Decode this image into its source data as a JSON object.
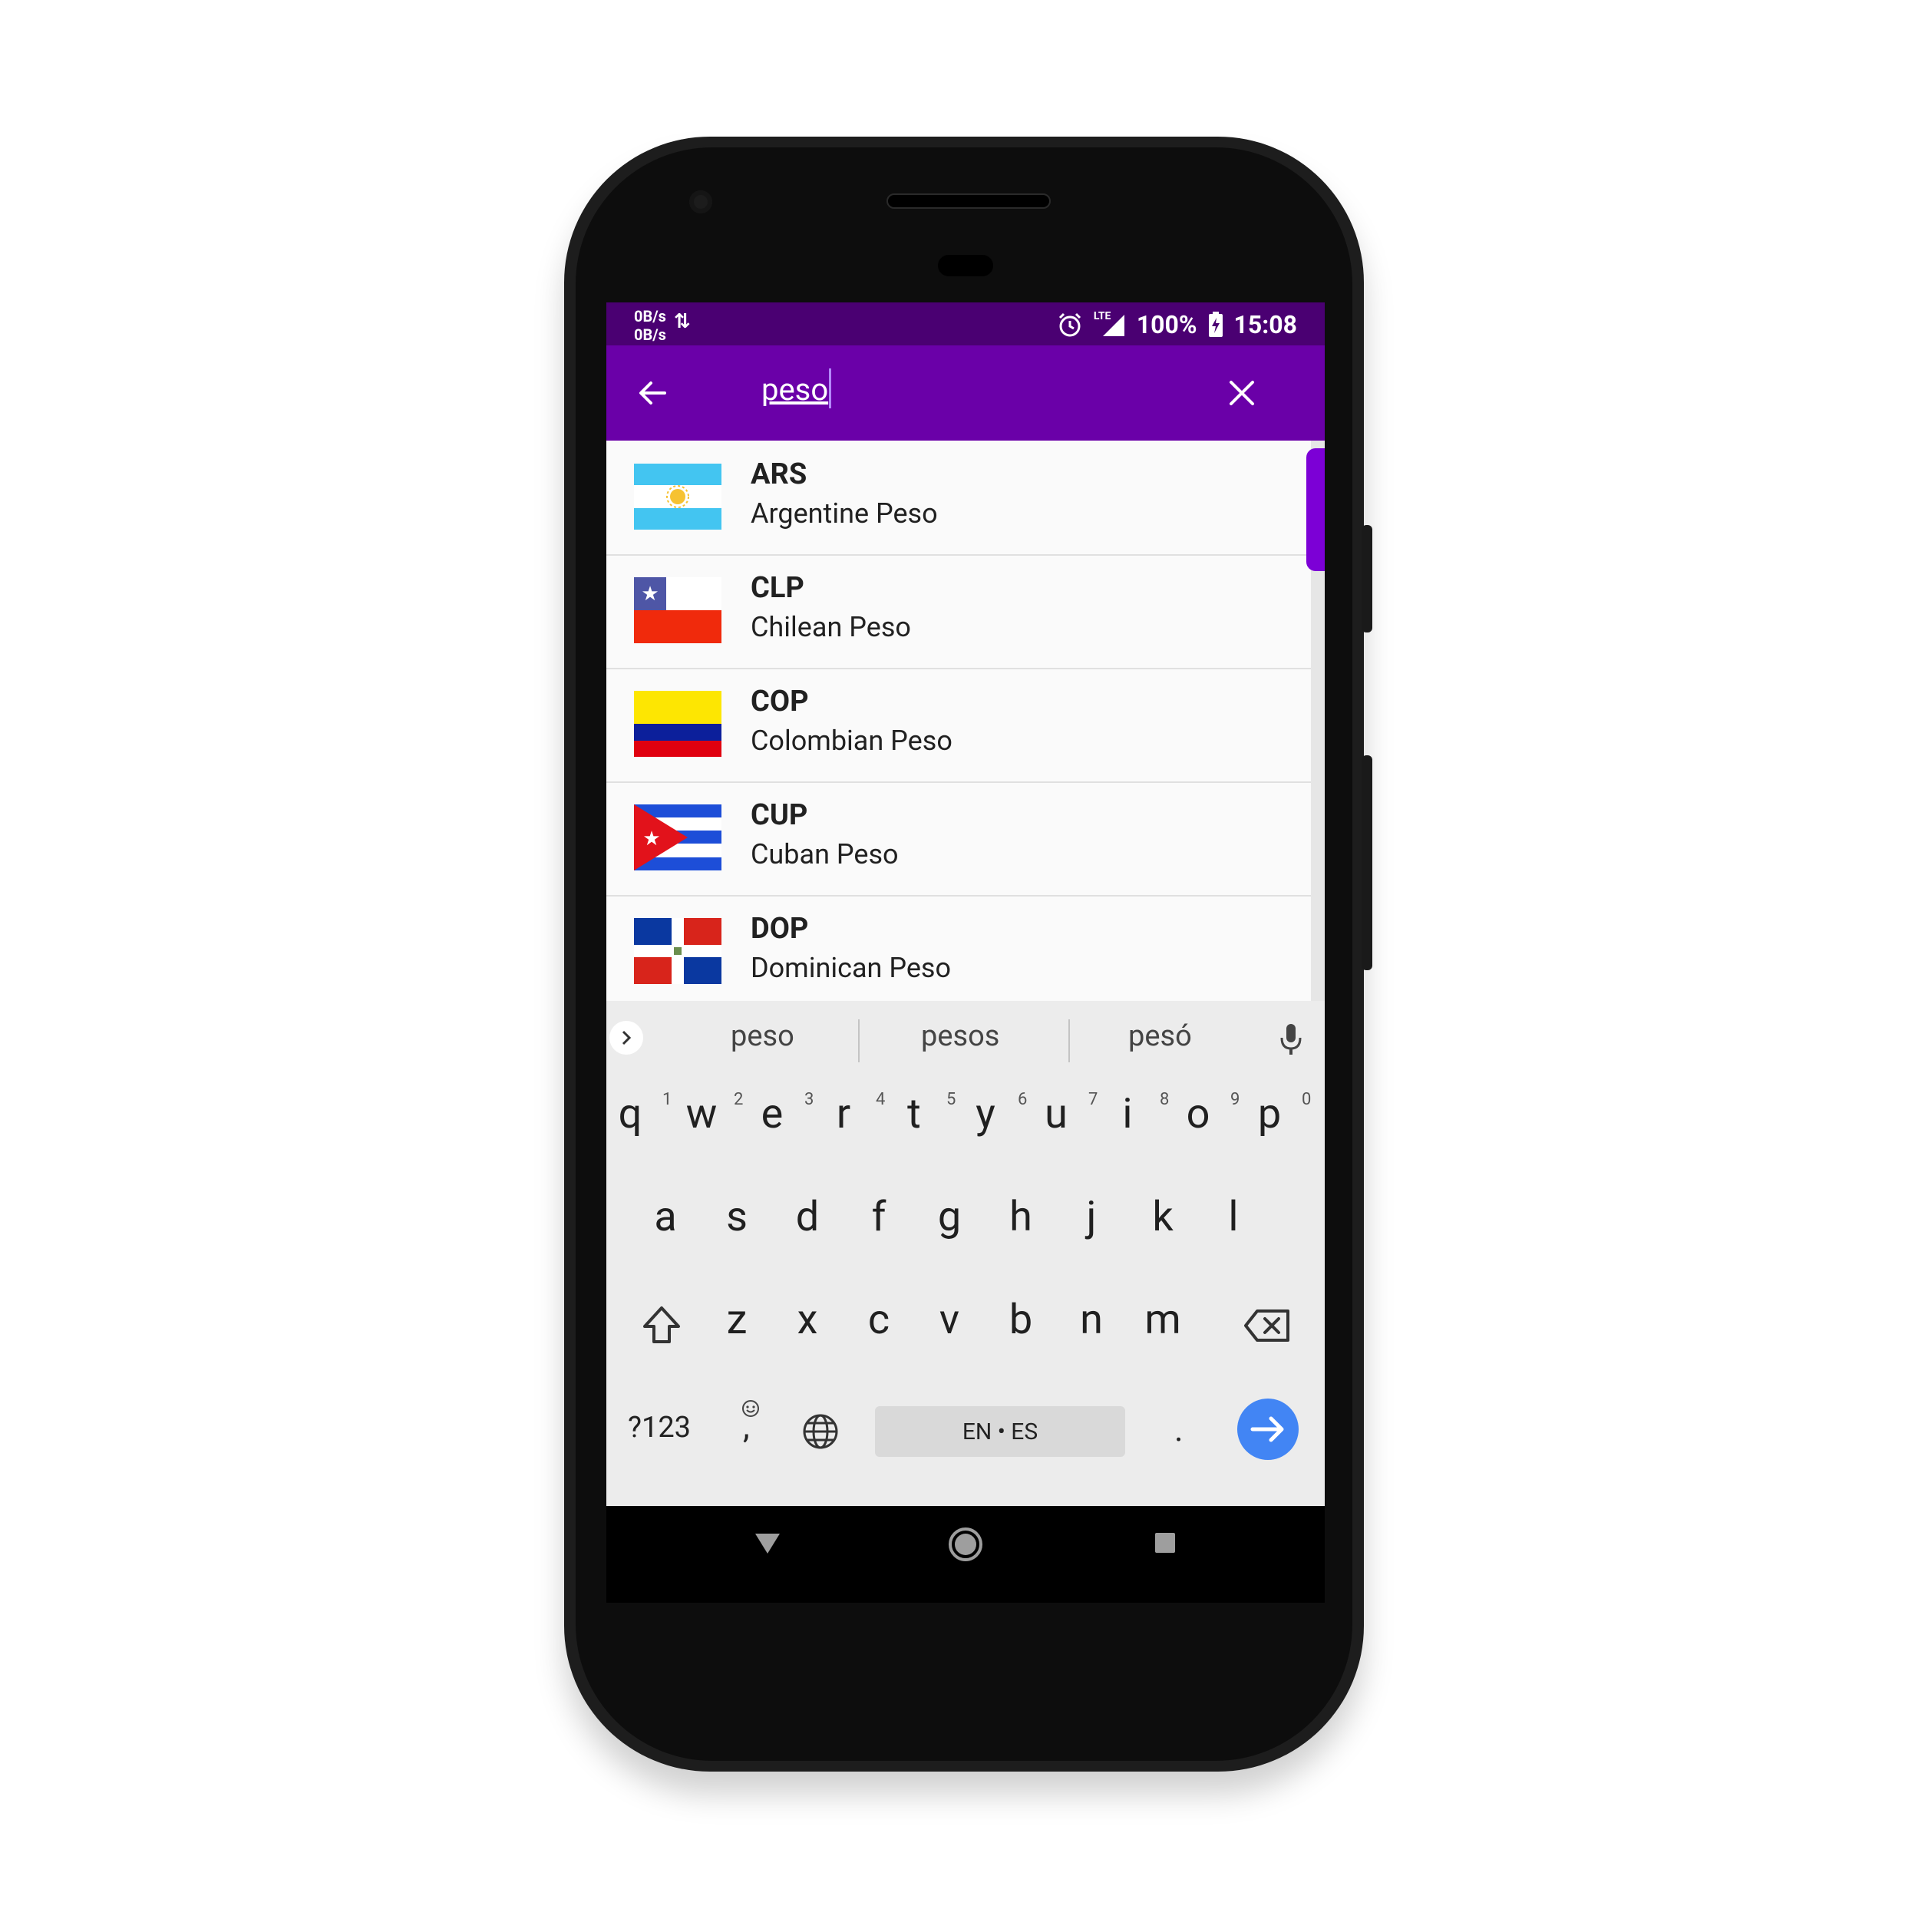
{
  "status_bar": {
    "net_up": "0B/s",
    "net_down": "0B/s",
    "network_label": "LTE",
    "battery": "100%",
    "time": "15:08"
  },
  "search": {
    "query": "peso"
  },
  "currencies": [
    {
      "code": "ARS",
      "name": "Argentine Peso",
      "flag": "argentina-flag"
    },
    {
      "code": "CLP",
      "name": "Chilean Peso",
      "flag": "chile-flag"
    },
    {
      "code": "COP",
      "name": "Colombian Peso",
      "flag": "colombia-flag"
    },
    {
      "code": "CUP",
      "name": "Cuban Peso",
      "flag": "cuba-flag"
    },
    {
      "code": "DOP",
      "name": "Dominican Peso",
      "flag": "dominican-republic-flag"
    }
  ],
  "keyboard": {
    "suggestions": [
      "peso",
      "pesos",
      "pesó"
    ],
    "row1": [
      "q",
      "w",
      "e",
      "r",
      "t",
      "y",
      "u",
      "i",
      "o",
      "p"
    ],
    "row1_numbers": [
      "1",
      "2",
      "3",
      "4",
      "5",
      "6",
      "7",
      "8",
      "9",
      "0"
    ],
    "row2": [
      "a",
      "s",
      "d",
      "f",
      "g",
      "h",
      "j",
      "k",
      "l"
    ],
    "row3": [
      "z",
      "x",
      "c",
      "v",
      "b",
      "n",
      "m"
    ],
    "symbols_label": "?123",
    "comma_label": ",",
    "space_label": "EN • ES",
    "period_label": "."
  },
  "colors": {
    "status_bar": "#4a0072",
    "app_bar": "#6a00a8",
    "accent": "#7c00d6",
    "enter_key": "#4285f4"
  }
}
